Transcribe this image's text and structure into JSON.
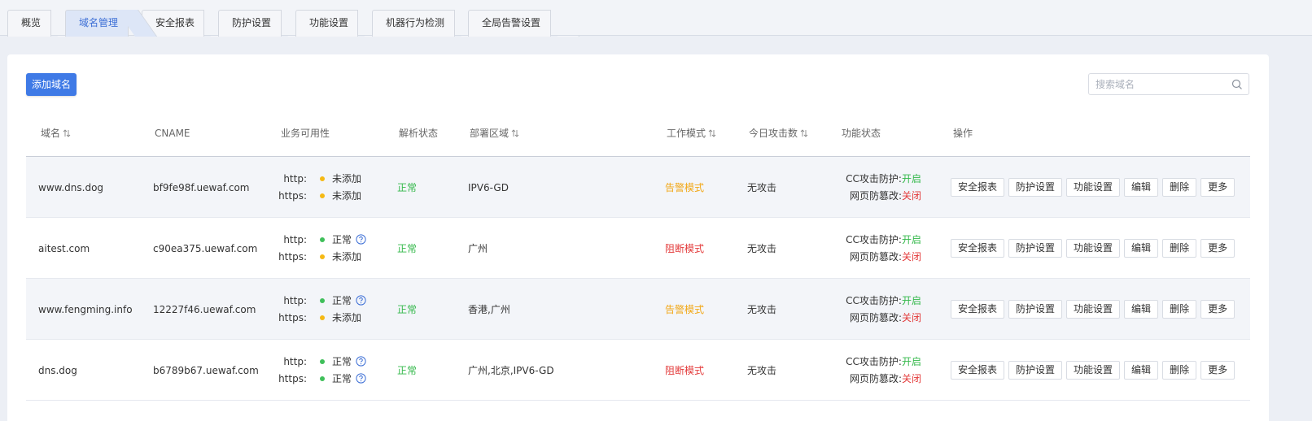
{
  "tabs": [
    {
      "label": "概览",
      "active": false
    },
    {
      "label": "域名管理",
      "active": true
    },
    {
      "label": "安全报表",
      "active": false
    },
    {
      "label": "防护设置",
      "active": false
    },
    {
      "label": "功能设置",
      "active": false
    },
    {
      "label": "机器行为检测",
      "active": false
    },
    {
      "label": "全局告警设置",
      "active": false
    }
  ],
  "toolbar": {
    "add_label": "添加域名"
  },
  "search": {
    "placeholder": "搜索域名",
    "value": ""
  },
  "table": {
    "headers": {
      "domain": "域名",
      "cname": "CNAME",
      "availability": "业务可用性",
      "resolve": "解析状态",
      "region": "部署区域",
      "mode": "工作模式",
      "attacks": "今日攻击数",
      "func": "功能状态",
      "ops": "操作"
    },
    "rows": [
      {
        "domain": "www.dns.dog",
        "cname": "bf9fe98f.uewaf.com",
        "http_label": "http:",
        "http_status": "未添加",
        "http_ok": false,
        "https_label": "https:",
        "https_status": "未添加",
        "https_ok": false,
        "resolve": "正常",
        "region": "IPV6-GD",
        "mode": "告警模式",
        "mode_type": "alert",
        "attacks": "无攻击",
        "cc_label": "CC攻击防护:",
        "cc_value": "开启",
        "tamper_label": "网页防篡改:",
        "tamper_value": "关闭"
      },
      {
        "domain": "aitest.com",
        "cname": "c90ea375.uewaf.com",
        "http_label": "http:",
        "http_status": "正常",
        "http_ok": true,
        "https_label": "https:",
        "https_status": "未添加",
        "https_ok": false,
        "resolve": "正常",
        "region": "广州",
        "mode": "阻断模式",
        "mode_type": "block",
        "attacks": "无攻击",
        "cc_label": "CC攻击防护:",
        "cc_value": "开启",
        "tamper_label": "网页防篡改:",
        "tamper_value": "关闭"
      },
      {
        "domain": "www.fengming.info",
        "cname": "12227f46.uewaf.com",
        "http_label": "http:",
        "http_status": "正常",
        "http_ok": true,
        "https_label": "https:",
        "https_status": "未添加",
        "https_ok": false,
        "resolve": "正常",
        "region": "香港,广州",
        "mode": "告警模式",
        "mode_type": "alert",
        "attacks": "无攻击",
        "cc_label": "CC攻击防护:",
        "cc_value": "开启",
        "tamper_label": "网页防篡改:",
        "tamper_value": "关闭"
      },
      {
        "domain": "dns.dog",
        "cname": "b6789b67.uewaf.com",
        "http_label": "http:",
        "http_status": "正常",
        "http_ok": true,
        "https_label": "https:",
        "https_status": "正常",
        "https_ok": true,
        "resolve": "正常",
        "region": "广州,北京,IPV6-GD",
        "mode": "阻断模式",
        "mode_type": "block",
        "attacks": "无攻击",
        "cc_label": "CC攻击防护:",
        "cc_value": "开启",
        "tamper_label": "网页防篡改:",
        "tamper_value": "关闭"
      }
    ],
    "row_actions": [
      "安全报表",
      "防护设置",
      "功能设置",
      "编辑",
      "删除",
      "更多"
    ]
  },
  "colors": {
    "accent": "#3f7ae6",
    "ok": "#33b84a",
    "alert": "#f2a818",
    "danger": "#e33b3b",
    "dot_warn": "#f5b914"
  },
  "icons": {
    "search": "search-icon",
    "sort": "sort-icon",
    "help": "help-icon"
  }
}
